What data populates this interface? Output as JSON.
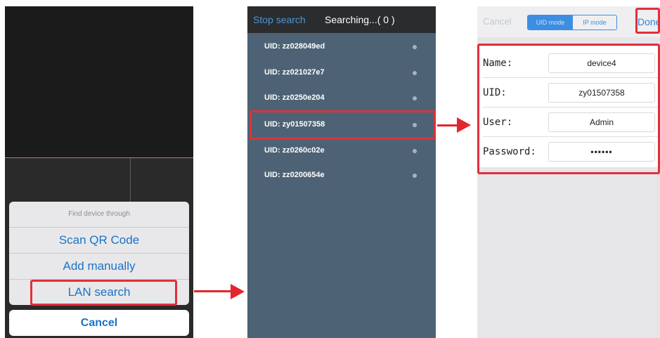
{
  "panel1": {
    "sheet_header": "Find device through",
    "options": [
      "Scan QR Code",
      "Add manually",
      "LAN search"
    ],
    "cancel_label": "Cancel"
  },
  "panel2": {
    "stop_label": "Stop search",
    "status": "Searching...( 0 )",
    "uids": [
      "UID: zz028049ed",
      "UID: zz021027e7",
      "UID: zz0250e204",
      "UID: zy01507358",
      "UID: zz0260c02e",
      "UID: zz0200654e"
    ]
  },
  "panel3": {
    "cancel_label": "Cancel",
    "mode_uid": "UID mode",
    "mode_ip": "IP mode",
    "done_label": "Done",
    "fields": [
      {
        "label": "Name:",
        "value": "device4"
      },
      {
        "label": "UID:",
        "value": "zy01507358"
      },
      {
        "label": "User:",
        "value": "Admin"
      },
      {
        "label": "Password:",
        "value": "••••••"
      }
    ]
  },
  "colors": {
    "accent_blue": "#1a73c8",
    "highlight_red": "#e0303b",
    "list_bg": "#4d6375"
  }
}
